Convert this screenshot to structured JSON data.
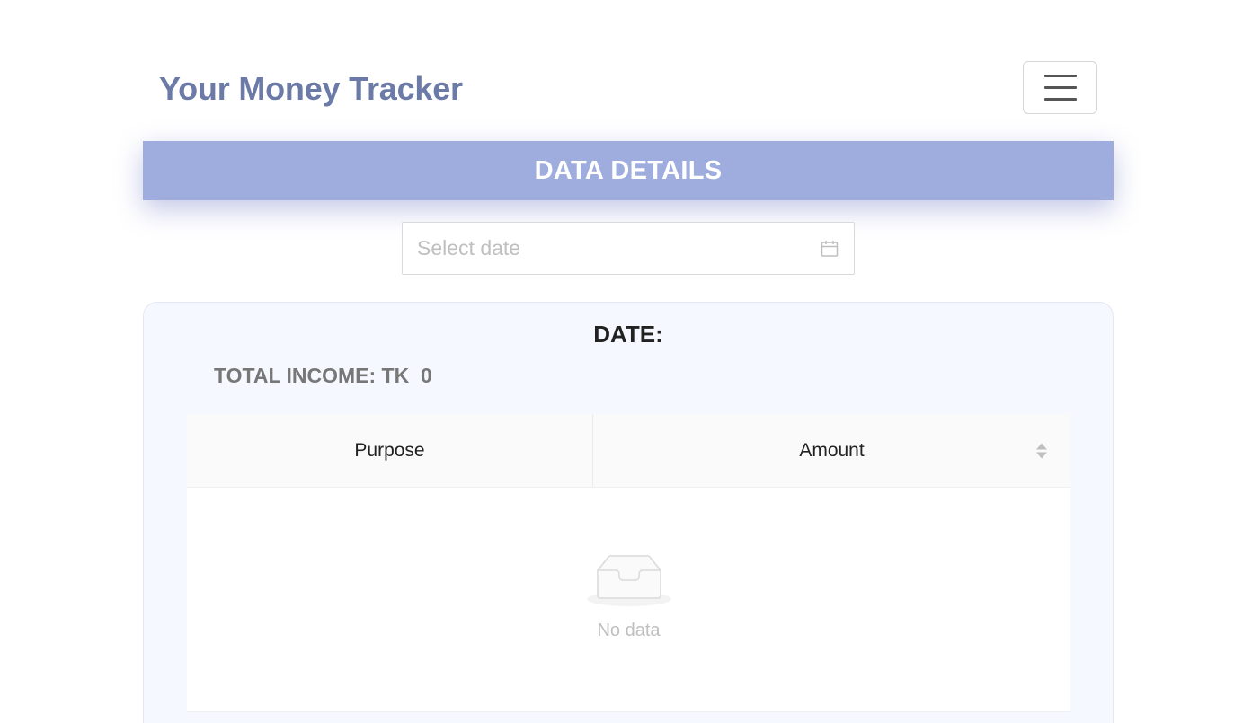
{
  "header": {
    "brand": "Your Money Tracker",
    "menu_icon": "hamburger-menu-icon"
  },
  "banner": {
    "title": "DATA DETAILS",
    "color": "#9fadde"
  },
  "date_picker": {
    "placeholder": "Select date",
    "value": "",
    "icon": "calendar-icon"
  },
  "summary": {
    "date_label": "DATE:",
    "total_income": "TOTAL INCOME: TK  0"
  },
  "table": {
    "columns": [
      "Purpose",
      "Amount"
    ],
    "rows": [],
    "empty_text": "No data",
    "empty_icon": "empty-inbox-icon",
    "sort_icon": "sort-icon"
  }
}
